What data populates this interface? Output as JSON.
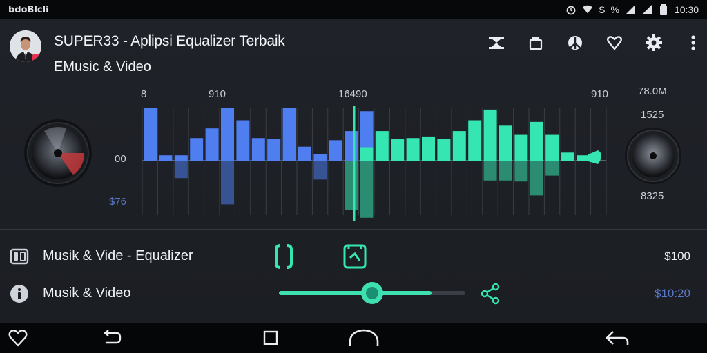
{
  "status_bar": {
    "carrier": "bdoBlcli",
    "icons": [
      "alarm-icon",
      "wifi-icon",
      "s-icon",
      "percent-icon",
      "signal-icon",
      "signal-icon",
      "battery-icon"
    ],
    "labels": {
      "s": "S",
      "percent": "%"
    },
    "time": "10:30"
  },
  "header": {
    "title": "SUPER33 - Aplipsi Equalizer Terbaik",
    "subtitle": "EMusic & Video",
    "toolbar_icons": [
      "hourglass-icon",
      "bag-icon",
      "peace-icon",
      "heart-icon",
      "gear-icon",
      "more-vert-icon"
    ]
  },
  "equalizer": {
    "top_labels": [
      "8",
      "910",
      "16490",
      "910"
    ],
    "left_labels": [
      "00",
      "$76"
    ],
    "right_labels": [
      "78.0M",
      "1525",
      "8325"
    ],
    "accent_blue": "#4f7ef0",
    "accent_green": "#36e6b2",
    "blue_bars": [
      {
        "up": 0.98,
        "down": 0.0
      },
      {
        "up": 0.1,
        "down": 0.0
      },
      {
        "up": 0.1,
        "down": 0.35
      },
      {
        "up": 0.42,
        "down": 0.0
      },
      {
        "up": 0.6,
        "down": 0.0
      },
      {
        "up": 0.98,
        "down": 0.88
      },
      {
        "up": 0.75,
        "down": 0.0
      },
      {
        "up": 0.42,
        "down": 0.0
      },
      {
        "up": 0.4,
        "down": 0.0
      },
      {
        "up": 0.98,
        "down": 0.0
      },
      {
        "up": 0.26,
        "down": 0.0
      },
      {
        "up": 0.12,
        "down": 0.38
      },
      {
        "up": 0.38,
        "down": 0.0
      },
      {
        "up": 0.55,
        "down": 0.0
      },
      {
        "up": 0.92,
        "down": 0.0
      }
    ],
    "green_bars": [
      {
        "up": 0.0,
        "down": 1.0
      },
      {
        "up": 0.25,
        "down": 1.15
      },
      {
        "up": 0.55,
        "down": 0.0
      },
      {
        "up": 0.4,
        "down": 0.0
      },
      {
        "up": 0.42,
        "down": 0.0
      },
      {
        "up": 0.45,
        "down": 0.0
      },
      {
        "up": 0.4,
        "down": 0.0
      },
      {
        "up": 0.55,
        "down": 0.0
      },
      {
        "up": 0.75,
        "down": 0.0
      },
      {
        "up": 0.95,
        "down": 0.4
      },
      {
        "up": 0.65,
        "down": 0.4
      },
      {
        "up": 0.48,
        "down": 0.42
      },
      {
        "up": 0.72,
        "down": 0.7
      },
      {
        "up": 0.48,
        "down": 0.3
      },
      {
        "up": 0.15,
        "down": 0.0
      },
      {
        "up": 0.1,
        "down": 0.0
      }
    ]
  },
  "list": {
    "rows": [
      {
        "icon": "split-screen-icon",
        "label": "Musik & Vide - Equalizer",
        "value": "$100"
      },
      {
        "icon": "info-icon",
        "label": "Musik & Video",
        "value": "$10:20"
      }
    ],
    "middle_icons": [
      "bracket-icon",
      "tag-icon",
      "share-icon"
    ],
    "slider_value": 0.44,
    "slider_fill": 0.82
  },
  "nav_bar": {
    "icons": [
      "heart-outline-icon",
      "undo-icon",
      "square-icon",
      "home-dome-icon",
      "back-arrow-icon"
    ]
  }
}
